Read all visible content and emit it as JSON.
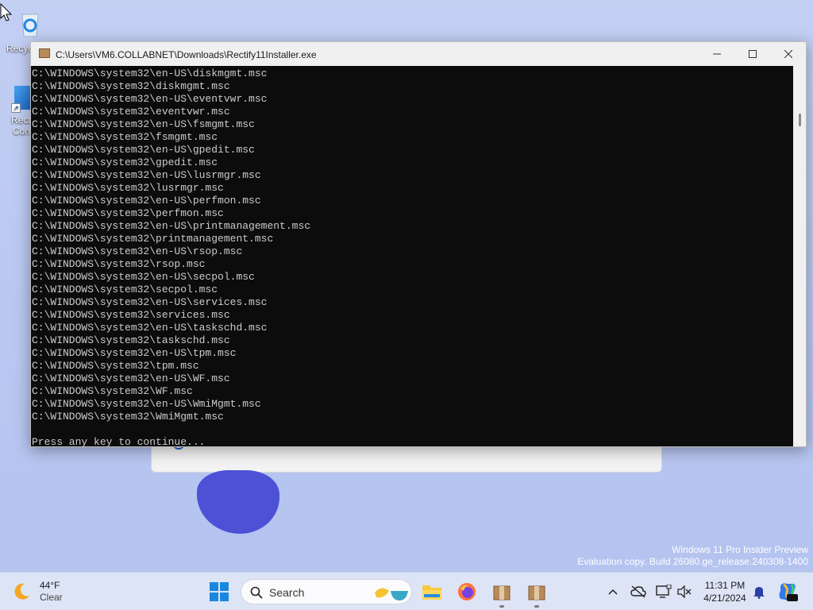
{
  "desktop": {
    "icons": [
      {
        "label": "Recycle Bin",
        "visible_label": "Recyc"
      },
      {
        "label_line1": "Rect",
        "label_line2": "Con"
      }
    ],
    "watermark_line1": "Windows 11 Pro Insider Preview",
    "watermark_line2": "Evaluation copy. Build 26080.ge_release.240308-1400"
  },
  "console": {
    "title": "C:\\Users\\VM6.COLLABNET\\Downloads\\Rectify11Installer.exe",
    "lines": [
      "C:\\WINDOWS\\system32\\en-US\\diskmgmt.msc",
      "C:\\WINDOWS\\system32\\diskmgmt.msc",
      "C:\\WINDOWS\\system32\\en-US\\eventvwr.msc",
      "C:\\WINDOWS\\system32\\eventvwr.msc",
      "C:\\WINDOWS\\system32\\en-US\\fsmgmt.msc",
      "C:\\WINDOWS\\system32\\fsmgmt.msc",
      "C:\\WINDOWS\\system32\\en-US\\gpedit.msc",
      "C:\\WINDOWS\\system32\\gpedit.msc",
      "C:\\WINDOWS\\system32\\en-US\\lusrmgr.msc",
      "C:\\WINDOWS\\system32\\lusrmgr.msc",
      "C:\\WINDOWS\\system32\\en-US\\perfmon.msc",
      "C:\\WINDOWS\\system32\\perfmon.msc",
      "C:\\WINDOWS\\system32\\en-US\\printmanagement.msc",
      "C:\\WINDOWS\\system32\\printmanagement.msc",
      "C:\\WINDOWS\\system32\\en-US\\rsop.msc",
      "C:\\WINDOWS\\system32\\rsop.msc",
      "C:\\WINDOWS\\system32\\en-US\\secpol.msc",
      "C:\\WINDOWS\\system32\\secpol.msc",
      "C:\\WINDOWS\\system32\\en-US\\services.msc",
      "C:\\WINDOWS\\system32\\services.msc",
      "C:\\WINDOWS\\system32\\en-US\\taskschd.msc",
      "C:\\WINDOWS\\system32\\taskschd.msc",
      "C:\\WINDOWS\\system32\\en-US\\tpm.msc",
      "C:\\WINDOWS\\system32\\tpm.msc",
      "C:\\WINDOWS\\system32\\en-US\\WF.msc",
      "C:\\WINDOWS\\system32\\WF.msc",
      "C:\\WINDOWS\\system32\\en-US\\WmiMgmt.msc",
      "C:\\WINDOWS\\system32\\WmiMgmt.msc",
      "",
      "Press any key to continue..."
    ]
  },
  "taskbar": {
    "weather_temp": "44°F",
    "weather_text": "Clear",
    "search_label": "Search",
    "time": "11:31 PM",
    "date": "4/21/2024"
  }
}
